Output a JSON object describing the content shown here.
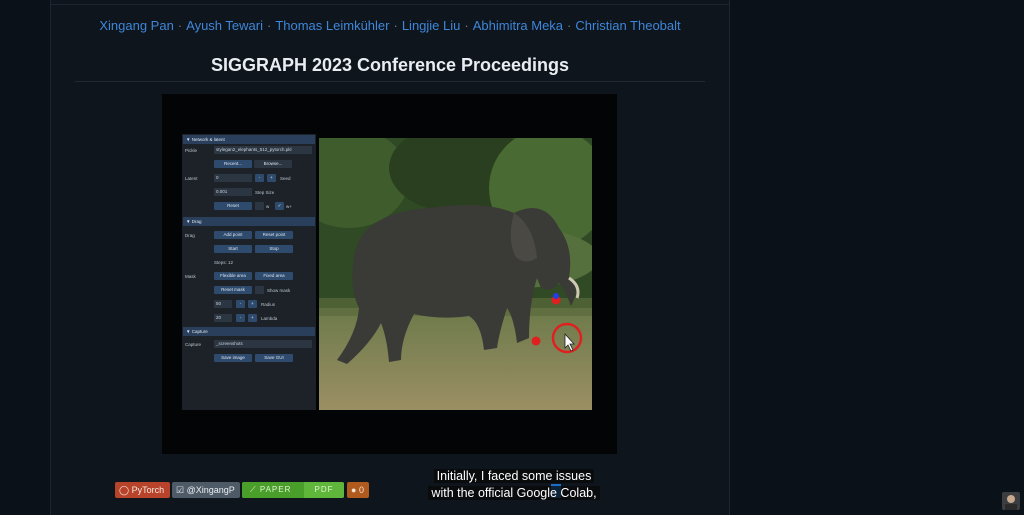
{
  "authors": [
    "Xingang Pan",
    "Ayush Tewari",
    "Thomas Leimkühler",
    "Lingjie Liu",
    "Abhimitra Meka",
    "Christian Theobalt"
  ],
  "author_separator": "·",
  "venue": "SIGGRAPH 2023 Conference Proceedings",
  "video": {
    "gui": {
      "sections": {
        "network": "Network & latent",
        "drag": "Drag",
        "capture": "Capture"
      },
      "pickle_label": "Pickle",
      "pickle_value": "stylegan2_elephants_512_pytorch.pkl",
      "recent_button": "Recent...",
      "browse_button": "Browse...",
      "latent_label": "Latent",
      "latent_value": "0",
      "seed_label": "Seed",
      "step_value": "0.001",
      "step_label": "Step Size",
      "reset_button": "Reset",
      "w_label": "w",
      "wplus_label": "w+",
      "drag_label": "Drag",
      "add_point_button": "Add point",
      "reset_point_button": "Reset point",
      "start_button": "Start",
      "stop_button": "Stop",
      "steps_text": "Steps: 12",
      "mask_label": "Mask",
      "flexible_area_button": "Flexible area",
      "fixed_area_button": "Fixed area",
      "reset_mask_button": "Reset mask",
      "show_mask_label": "Show mask",
      "radius_value": "50",
      "radius_label": "Radius",
      "lambda_value": "20",
      "lambda_label": "Lambda",
      "capture_label": "Capture",
      "capture_path": "_screenshots",
      "save_image_button": "Save image",
      "save_gui_button": "Save GUI",
      "minus": "-",
      "plus": "+"
    }
  },
  "links": {
    "pytorch": "PyTorch",
    "twitter": "@XingangP",
    "paper_left": "PAPER",
    "paper_right": "PDF",
    "other": "0"
  },
  "subtitle": {
    "line1": "Initially, I faced some issues",
    "line2": "with the official Google Colab,"
  },
  "colors": {
    "link": "#3e86d8",
    "background": "#0b1118",
    "handle_point": "#e02020",
    "target_point": "#2040e0"
  }
}
